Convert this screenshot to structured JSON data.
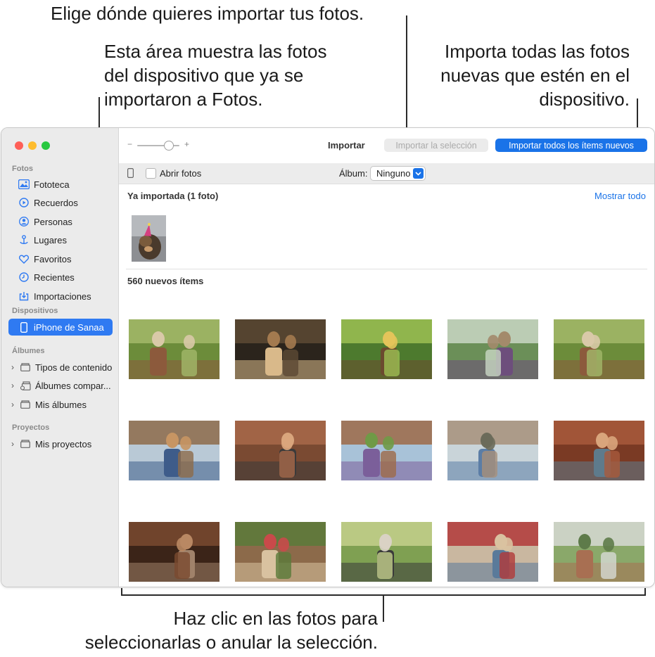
{
  "callouts": {
    "top": "Elige dónde quieres importar tus fotos.",
    "left": [
      "Esta área muestra las fotos",
      "del dispositivo que ya se",
      "importaron a Fotos."
    ],
    "right": [
      "Importa todas las fotos",
      "nuevas que estén en el",
      "dispositivo."
    ],
    "bottom": [
      "Haz clic en las fotos para",
      "seleccionarlas o anular la selección."
    ]
  },
  "colors": {
    "accent": "#1a73e8",
    "selected": "#2f7af2",
    "close": "#fe5f57",
    "minimize": "#febc2e",
    "zoom": "#28c840"
  },
  "sidebar": {
    "sections": {
      "fotos": "Fotos",
      "dispositivos": "Dispositivos",
      "albumes": "Álbumes",
      "proyectos": "Proyectos"
    },
    "fotos_items": [
      {
        "label": "Fototeca",
        "icon": "library-icon"
      },
      {
        "label": "Recuerdos",
        "icon": "memories-icon"
      },
      {
        "label": "Personas",
        "icon": "people-icon"
      },
      {
        "label": "Lugares",
        "icon": "places-icon"
      },
      {
        "label": "Favoritos",
        "icon": "heart-icon"
      },
      {
        "label": "Recientes",
        "icon": "clock-icon"
      },
      {
        "label": "Importaciones",
        "icon": "import-icon"
      }
    ],
    "device": {
      "label": "iPhone de Sanaa",
      "icon": "iphone-icon",
      "selected": true
    },
    "album_groups": [
      {
        "label": "Tipos de contenido",
        "icon": "folder-icon"
      },
      {
        "label": "Álbumes compar...",
        "icon": "shared-albums-icon"
      },
      {
        "label": "Mis álbumes",
        "icon": "folder-icon"
      }
    ],
    "project_groups": [
      {
        "label": "Mis proyectos",
        "icon": "folder-icon"
      }
    ]
  },
  "toolbar": {
    "zoom_minus": "−",
    "zoom_plus": "+",
    "title": "Importar",
    "import_selection": "Importar la selección",
    "import_all": "Importar todos los ítems nuevos"
  },
  "options": {
    "open_photos": "Abrir fotos",
    "album_label": "Álbum:",
    "album_value": "Ninguno"
  },
  "already_imported": {
    "title": "Ya importada (1 foto)",
    "show_all": "Mostrar todo"
  },
  "new_items": {
    "title": "560 nuevos ítems",
    "photos": [
      {
        "scene": "friends-hiking-laughing"
      },
      {
        "scene": "man-in-cafe"
      },
      {
        "scene": "man-in-garden"
      },
      {
        "scene": "woman-with-backpack"
      },
      {
        "scene": "friends-hiking-laughing"
      },
      {
        "scene": "group-at-temple"
      },
      {
        "scene": "group-sitting-at-ruins"
      },
      {
        "scene": "woman-at-temple"
      },
      {
        "scene": "people-by-river"
      },
      {
        "scene": "woman-in-doorway"
      },
      {
        "scene": "couple-walking-corridor"
      },
      {
        "scene": "woman-with-tree-roots"
      },
      {
        "scene": "friends-lying-on-grass"
      },
      {
        "scene": "woman-at-market"
      },
      {
        "scene": "friends-cheering-outdoors"
      }
    ]
  }
}
